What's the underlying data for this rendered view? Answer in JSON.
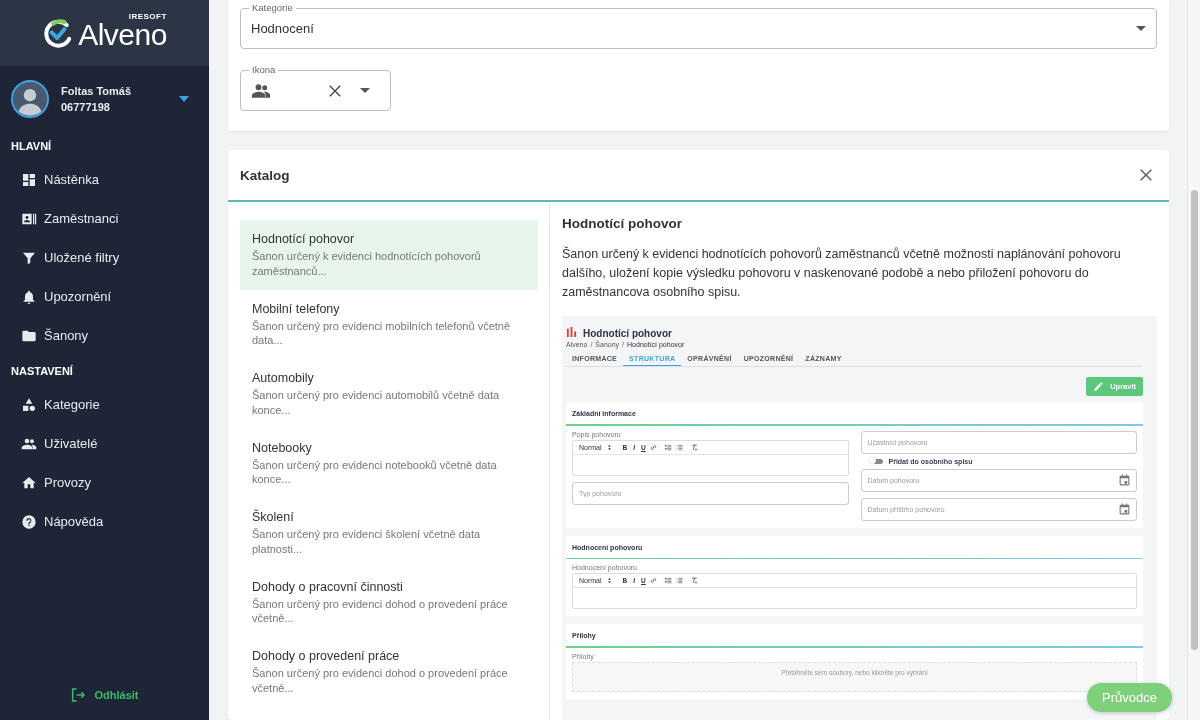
{
  "sidebar": {
    "logo": {
      "brand": "Alveno",
      "vendor": "IRESOFT"
    },
    "user": {
      "name": "Foltas Tomáš",
      "id": "06777198"
    },
    "sections": [
      {
        "title": "HLAVNÍ",
        "items": [
          {
            "label": "Nástěnka"
          },
          {
            "label": "Zaměstnanci"
          },
          {
            "label": "Uložené filtry"
          },
          {
            "label": "Upozornění"
          },
          {
            "label": "Šanony"
          }
        ]
      },
      {
        "title": "NASTAVENÍ",
        "items": [
          {
            "label": "Kategorie"
          },
          {
            "label": "Uživatelé"
          },
          {
            "label": "Provozy"
          },
          {
            "label": "Nápověda"
          }
        ]
      }
    ],
    "logout": "Odhlásit"
  },
  "form": {
    "category": {
      "label": "Kategorie",
      "value": "Hodnocení"
    },
    "icon_field": {
      "label": "Ikona"
    }
  },
  "catalog": {
    "title": "Katalog",
    "items": [
      {
        "title": "Hodnotící pohovor",
        "description": "Šanon určený k evidenci hodnotících pohovorů zaměstnanců...",
        "selected": true
      },
      {
        "title": "Mobilní telefony",
        "description": "Šanon určený pro evidenci mobilních telefonů včetně data...",
        "selected": false
      },
      {
        "title": "Automobily",
        "description": "Šanon určený pro evidenci automobilů včetně data konce...",
        "selected": false
      },
      {
        "title": "Notebooky",
        "description": "Šanon určený pro evidenci notebooků včetně data konce...",
        "selected": false
      },
      {
        "title": "Školení",
        "description": "Šanon určený pro evidenci školení včetně data platnosti...",
        "selected": false
      },
      {
        "title": "Dohody o pracovní činnosti",
        "description": "Šanon určený pro evidenci dohod o provedení práce včetně...",
        "selected": false
      },
      {
        "title": "Dohody o provedení práce",
        "description": "Šanon určený pro evidenci dohod o provedení práce včetně...",
        "selected": false
      }
    ],
    "detail": {
      "title": "Hodnotící pohovor",
      "description": "Šanon určený k evidenci hodnotících pohovorů zaměstnanců včetně možnosti naplánování pohovoru dalšího, uložení kopie výsledku pohovoru v naskenované podobě a nebo přiložení pohovoru do zaměstnancova osobního spisu.",
      "preview": {
        "title": "Hodnotící pohovor",
        "breadcrumb": [
          "Alveno",
          "Šanony",
          "Hodnotící pohovor"
        ],
        "breadcrumb_separator": "/",
        "tabs": [
          {
            "label": "INFORMACE",
            "selected": false
          },
          {
            "label": "STRUKTURA",
            "selected": true
          },
          {
            "label": "OPRÁVNĚNÍ",
            "selected": false
          },
          {
            "label": "UPOZORNĚNÍ",
            "selected": false
          },
          {
            "label": "ZÁZNAMY",
            "selected": false
          }
        ],
        "edit_button": "Upravit",
        "sections": [
          {
            "title": "Základní informace",
            "columns": [
              [
                {
                  "kind": "editor",
                  "label": "Popis pohovoru",
                  "format": "Normal",
                  "buttons": [
                    "B",
                    "I",
                    "U"
                  ]
                },
                {
                  "kind": "input",
                  "placeholder": "Typ pohovoru"
                }
              ],
              [
                {
                  "kind": "input",
                  "placeholder": "Účastníci pohovoru"
                },
                {
                  "kind": "toggle",
                  "label": "Přidat do osobního spisu",
                  "on": false
                },
                {
                  "kind": "date",
                  "placeholder": "Datum pohovoru"
                },
                {
                  "kind": "date",
                  "placeholder": "Datum příštího pohovoru"
                }
              ]
            ]
          },
          {
            "title": "Hodnocení pohovoru",
            "columns": [
              [
                {
                  "kind": "editor",
                  "label": "Hodnocení pohovoru",
                  "format": "Normal",
                  "buttons": [
                    "B",
                    "I",
                    "U"
                  ]
                }
              ]
            ]
          },
          {
            "title": "Přílohy",
            "columns": [
              [
                {
                  "kind": "dropzone",
                  "label": "Přílohy",
                  "hint": "Přetáhněte sem soubory, nebo klikněte pro vybrání"
                }
              ]
            ]
          }
        ]
      }
    }
  },
  "guide_button": "Průvodce"
}
